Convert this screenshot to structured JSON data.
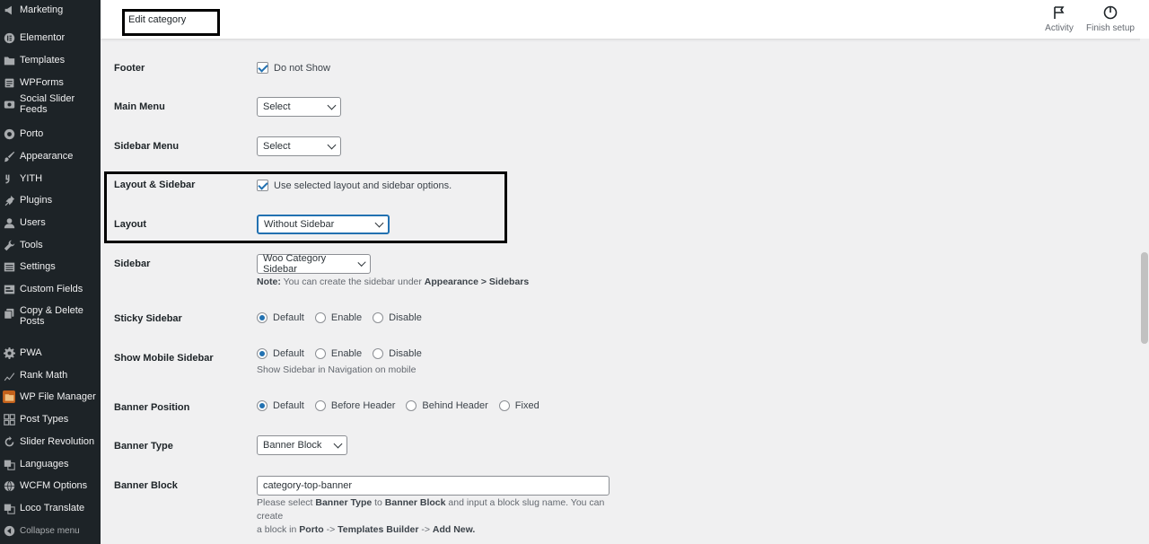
{
  "sidebar": {
    "items": [
      {
        "label": "Marketing",
        "icon": "megaphone-icon"
      },
      {
        "label": "Elementor",
        "icon": "elementor-icon"
      },
      {
        "label": "Templates",
        "icon": "folder-icon"
      },
      {
        "label": "WPForms",
        "icon": "forms-icon"
      },
      {
        "label": "Social Slider Feeds",
        "icon": "instagram-icon"
      },
      {
        "label": "Porto",
        "icon": "porto-icon"
      },
      {
        "label": "Appearance",
        "icon": "brush-icon"
      },
      {
        "label": "YITH",
        "icon": "yith-icon"
      },
      {
        "label": "Plugins",
        "icon": "plugin-icon"
      },
      {
        "label": "Users",
        "icon": "user-icon"
      },
      {
        "label": "Tools",
        "icon": "wrench-icon"
      },
      {
        "label": "Settings",
        "icon": "settings-icon"
      },
      {
        "label": "Custom Fields",
        "icon": "custom-fields-icon"
      },
      {
        "label": "Copy & Delete Posts",
        "icon": "copy-icon"
      },
      {
        "label": "PWA",
        "icon": "gear-icon"
      },
      {
        "label": "Rank Math",
        "icon": "rank-math-icon"
      },
      {
        "label": "WP File Manager",
        "icon": "file-manager-icon"
      },
      {
        "label": "Post Types",
        "icon": "grid-icon"
      },
      {
        "label": "Slider Revolution",
        "icon": "refresh-icon"
      },
      {
        "label": "Languages",
        "icon": "translate-icon"
      },
      {
        "label": "WCFM Options",
        "icon": "globe-icon"
      },
      {
        "label": "Loco Translate",
        "icon": "translate-icon"
      }
    ],
    "collapse_label": "Collapse menu"
  },
  "header": {
    "title": "Edit category",
    "activity_label": "Activity",
    "finish_setup_label": "Finish setup"
  },
  "form": {
    "footer": {
      "label": "Footer",
      "checkbox_label": "Do not Show",
      "checked": true
    },
    "main_menu": {
      "label": "Main Menu",
      "value": "Select"
    },
    "sidebar_menu": {
      "label": "Sidebar Menu",
      "value": "Select"
    },
    "layout_sidebar": {
      "label": "Layout & Sidebar",
      "checkbox_label": "Use selected layout and sidebar options.",
      "checked": true
    },
    "layout": {
      "label": "Layout",
      "value": "Without Sidebar"
    },
    "sidebar": {
      "label": "Sidebar",
      "value": "Woo Category Sidebar",
      "note_prefix": "Note:",
      "note_text": " You can create the sidebar under ",
      "note_link1": "Appearance",
      "note_sep": " > ",
      "note_link2": "Sidebars"
    },
    "sticky_sidebar": {
      "label": "Sticky Sidebar",
      "options": [
        "Default",
        "Enable",
        "Disable"
      ],
      "selected": "Default"
    },
    "show_mobile_sidebar": {
      "label": "Show Mobile Sidebar",
      "options": [
        "Default",
        "Enable",
        "Disable"
      ],
      "selected": "Default",
      "description": "Show Sidebar in Navigation on mobile"
    },
    "banner_position": {
      "label": "Banner Position",
      "options": [
        "Default",
        "Before Header",
        "Behind Header",
        "Fixed"
      ],
      "selected": "Default"
    },
    "banner_type": {
      "label": "Banner Type",
      "value": "Banner Block"
    },
    "banner_block": {
      "label": "Banner Block",
      "value": "category-top-banner",
      "help_1": "Please select ",
      "help_b1": "Banner Type",
      "help_2": " to ",
      "help_b2": "Banner Block",
      "help_3": " and input a block slug name. You can create",
      "help_4": "a block in ",
      "help_b3": "Porto",
      "help_5": " -> ",
      "help_b4": "Templates Builder",
      "help_6": " -> ",
      "help_b5": "Add New."
    }
  }
}
